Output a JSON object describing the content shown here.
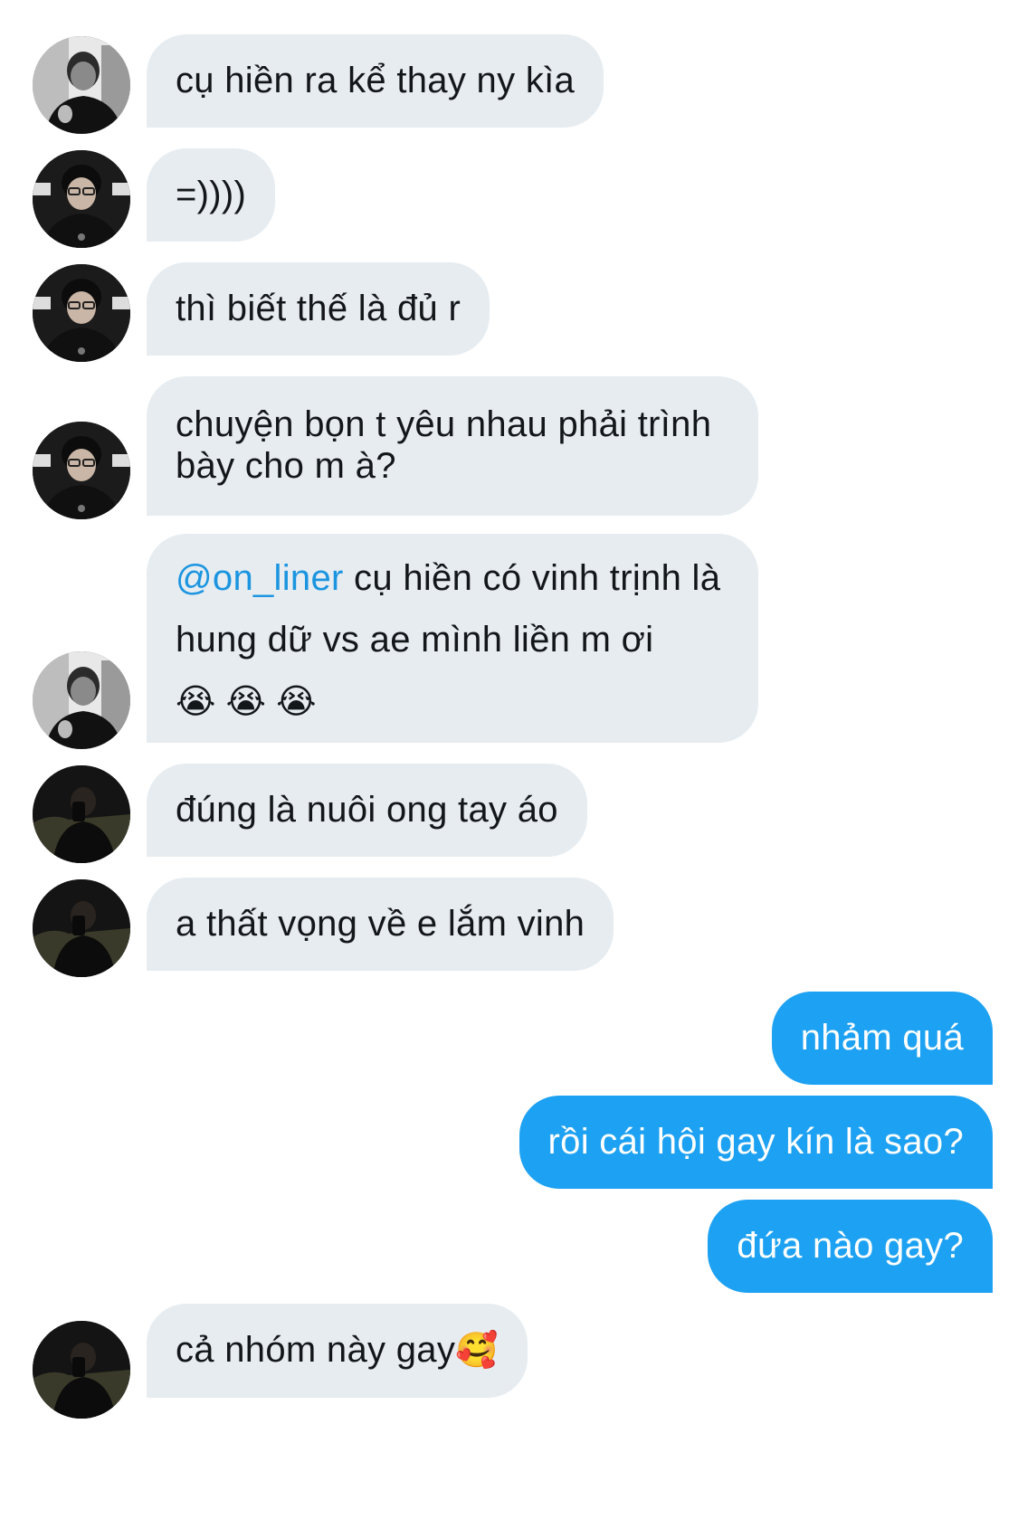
{
  "messages": [
    {
      "id": "m1",
      "side": "in",
      "avatar": "avatar-bw-portrait",
      "text": "cụ hiền ra kể thay ny kìa"
    },
    {
      "id": "m2",
      "side": "in",
      "avatar": "avatar-glasses-portrait",
      "text": "=))))"
    },
    {
      "id": "m3",
      "side": "in",
      "avatar": "avatar-glasses-portrait",
      "text": "thì biết thế là đủ r"
    },
    {
      "id": "m4",
      "side": "in",
      "avatar": "avatar-glasses-portrait",
      "text": "chuyện bọn t yêu nhau phải trình bày cho m à?"
    },
    {
      "id": "m5",
      "side": "in",
      "avatar": "avatar-bw-portrait",
      "mention": "@on_liner",
      "text": " cụ hiền có vinh trịnh là hung dữ vs ae mình liền m ơi",
      "emoji": "😭 😭 😭"
    },
    {
      "id": "m6",
      "side": "in",
      "avatar": "avatar-dark-portrait",
      "text": "đúng là nuôi ong tay áo"
    },
    {
      "id": "m7",
      "side": "in",
      "avatar": "avatar-dark-portrait",
      "text": "a thất vọng về e lắm vinh"
    },
    {
      "id": "m8",
      "side": "out",
      "text": "nhảm quá"
    },
    {
      "id": "m9",
      "side": "out",
      "text": "rồi cái hội gay kín là sao?"
    },
    {
      "id": "m10",
      "side": "out",
      "text": "đứa nào gay?"
    },
    {
      "id": "m11",
      "side": "in",
      "avatar": "avatar-dark-portrait",
      "text": "cả nhóm này gay",
      "emoji": "🥰"
    }
  ],
  "colors": {
    "incoming_bubble": "#e6ecf0",
    "outgoing_bubble": "#1da1f2",
    "mention": "#1b95e0",
    "text_dark": "#14171a"
  }
}
